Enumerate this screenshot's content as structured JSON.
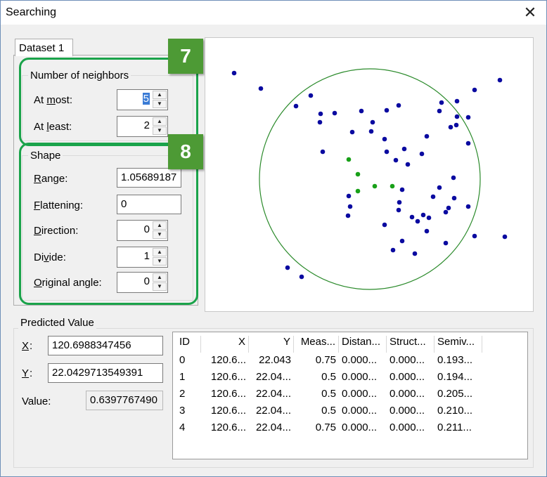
{
  "window": {
    "title": "Searching",
    "close_glyph": "✕"
  },
  "tab": {
    "label": "Dataset 1"
  },
  "badges": {
    "neighbors": "7",
    "shape": "8"
  },
  "neighbors": {
    "group_title": "Number of neighbors",
    "at_most": {
      "label_pre": "At ",
      "label_u": "m",
      "label_post": "ost:",
      "value": "5"
    },
    "at_least": {
      "label_pre": "At ",
      "label_u": "l",
      "label_post": "east:",
      "value": "2"
    }
  },
  "shape": {
    "group_title": "Shape",
    "range": {
      "label_pre": "",
      "label_u": "R",
      "label_post": "ange:",
      "value": "1.05689187"
    },
    "flattening": {
      "label_pre": "",
      "label_u": "F",
      "label_post": "lattening:",
      "value": "0"
    },
    "direction": {
      "label_pre": "",
      "label_u": "D",
      "label_post": "irection:",
      "value": "0"
    },
    "divide": {
      "label_pre": "Di",
      "label_u": "v",
      "label_post": "ide:",
      "value": "1"
    },
    "original_angle": {
      "label_pre": "",
      "label_u": "O",
      "label_post": "riginal angle:",
      "value": "0"
    }
  },
  "predicted": {
    "group_title": "Predicted Value",
    "x_label": "X",
    "x_value": "120.6988347456",
    "y_label": "Y",
    "y_value": "22.0429713549391",
    "value_label": "Value:",
    "value": "0.6397767490"
  },
  "table": {
    "columns": [
      "ID",
      "X",
      "Y",
      "Meas...",
      "Distan...",
      "Struct...",
      "Semiv..."
    ],
    "rows": [
      [
        "0",
        "120.6...",
        "22.043",
        "0.75",
        "0.000...",
        "0.000...",
        "0.193..."
      ],
      [
        "1",
        "120.6...",
        "22.04...",
        "0.5",
        "0.000...",
        "0.000...",
        "0.194..."
      ],
      [
        "2",
        "120.6...",
        "22.04...",
        "0.5",
        "0.000...",
        "0.000...",
        "0.205..."
      ],
      [
        "3",
        "120.6...",
        "22.04...",
        "0.5",
        "0.000...",
        "0.000...",
        "0.210..."
      ],
      [
        "4",
        "120.6...",
        "22.04...",
        "0.75",
        "0.000...",
        "0.000...",
        "0.211..."
      ]
    ]
  },
  "colors": {
    "point": "#0a0aa0",
    "neighbor_point": "#18a018",
    "circle": "#2a8a2a",
    "highlight": "#1aa34a",
    "badge": "#4d9a35"
  }
}
